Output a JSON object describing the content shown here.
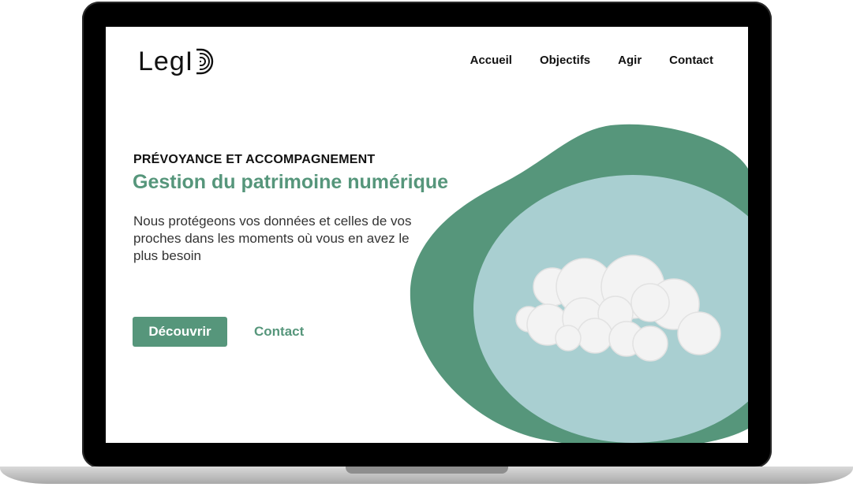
{
  "brand": {
    "logo_text": "LegI",
    "logo_mark_icon": "fingerprint-d-icon"
  },
  "nav": {
    "items": [
      {
        "label": "Accueil"
      },
      {
        "label": "Objectifs"
      },
      {
        "label": "Agir"
      },
      {
        "label": "Contact"
      }
    ]
  },
  "hero": {
    "kicker": "PRÉVOYANCE ET ACCOMPAGNEMENT",
    "headline": "Gestion du patrimoine numérique",
    "lead": "Nous protégeons vos données et celles de vos proches dans les moments où vous en avez le plus besoin",
    "primary_button": "Découvrir",
    "secondary_link": "Contact",
    "illustration_icon": "cloud-icon"
  },
  "colors": {
    "accent": "#56967b",
    "blob_dark": "#56967b",
    "blob_light": "#a9cfd1",
    "cloud": "#f3f3f3"
  }
}
